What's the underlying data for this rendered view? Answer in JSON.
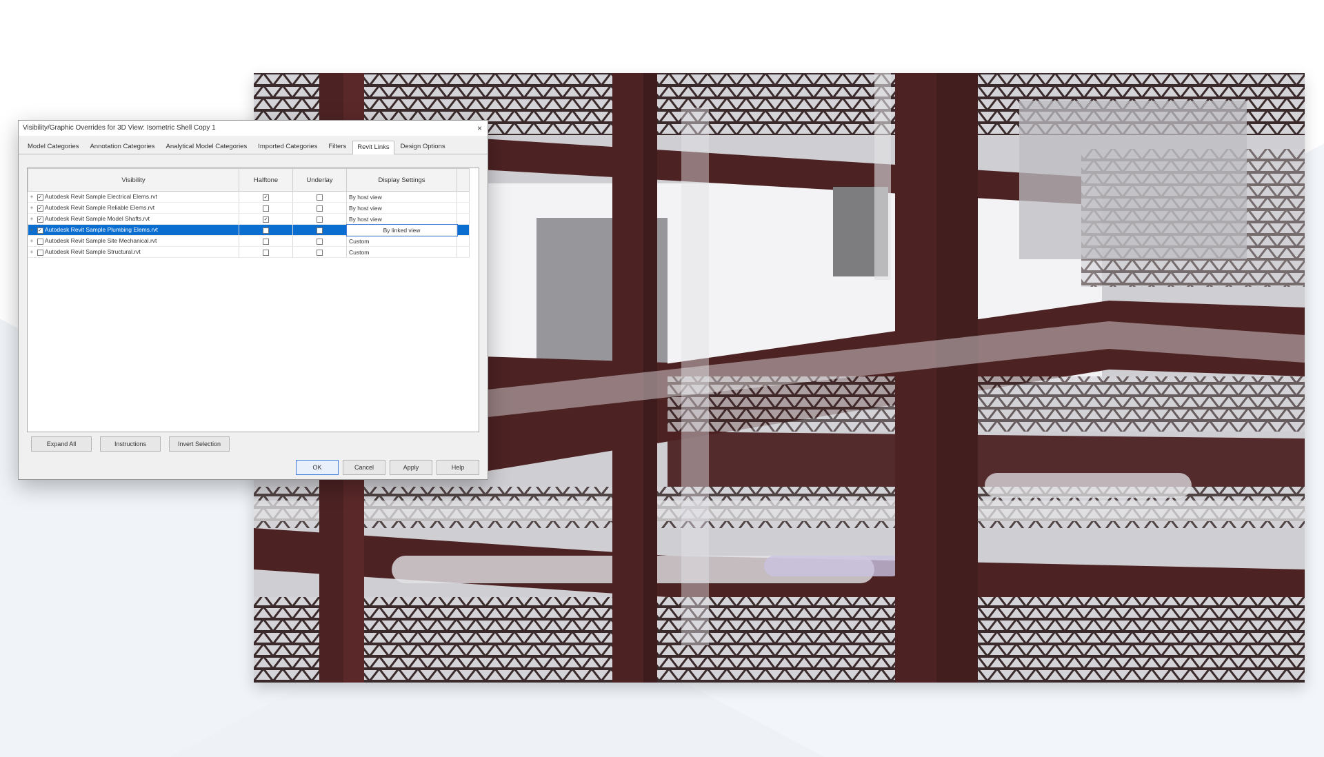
{
  "dialog": {
    "title": "Visibility/Graphic Overrides for 3D View: Isometric Shell Copy 1",
    "close_glyph": "×",
    "tabs": [
      {
        "label": "Model Categories"
      },
      {
        "label": "Annotation Categories"
      },
      {
        "label": "Analytical Model Categories"
      },
      {
        "label": "Imported Categories"
      },
      {
        "label": "Filters"
      },
      {
        "label": "Revit Links"
      },
      {
        "label": "Design Options"
      }
    ],
    "active_tab": 5,
    "columns": {
      "visibility": "Visibility",
      "halftone": "Halftone",
      "underlay": "Underlay",
      "display_settings": "Display Settings"
    },
    "rows": [
      {
        "name": "Autodesk Revit Sample Electrical Elems.rvt",
        "halftone": true,
        "underlay": false,
        "display": "By host view",
        "selected": false
      },
      {
        "name": "Autodesk Revit Sample Reliable Elems.rvt",
        "halftone": false,
        "underlay": false,
        "display": "By host view",
        "selected": false
      },
      {
        "name": "Autodesk Revit Sample Model Shafts.rvt",
        "halftone": true,
        "underlay": false,
        "display": "By host view",
        "selected": false
      },
      {
        "name": "Autodesk Revit Sample Plumbing Elems.rvt",
        "halftone": false,
        "underlay": false,
        "display": "By linked view",
        "selected": true
      },
      {
        "name": "Autodesk Revit Sample Site Mechanical.rvt",
        "halftone": false,
        "underlay": false,
        "display": "Custom",
        "selected": false
      },
      {
        "name": "Autodesk Revit Sample Structural.rvt",
        "halftone": false,
        "underlay": false,
        "display": "Custom",
        "selected": false
      }
    ],
    "buttons": {
      "expand_all": "Expand All",
      "instructions": "Instructions",
      "invert_selection": "Invert Selection",
      "ok": "OK",
      "cancel": "Cancel",
      "apply": "Apply",
      "help": "Help"
    }
  },
  "colors": {
    "steel": "#4d2223",
    "duct": "#e3e3e6",
    "selection": "#0a6ed1"
  }
}
